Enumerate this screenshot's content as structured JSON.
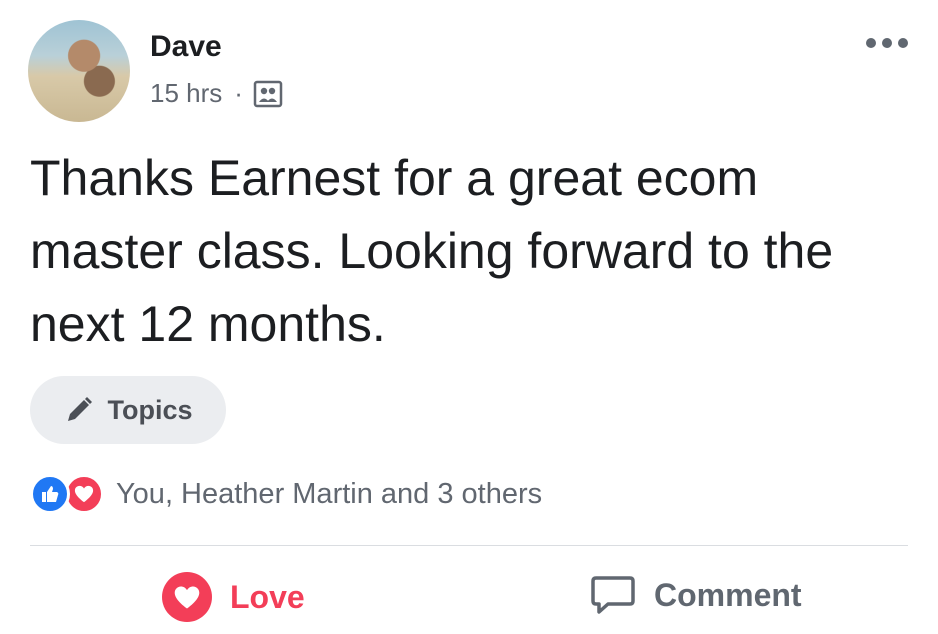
{
  "post": {
    "author": "Dave",
    "time": "15 hrs",
    "separator": "·",
    "audience_icon": "group-audience-icon",
    "more_icon": "more-options-icon",
    "text": "Thanks Earnest for a great ecom master class. Looking forward to the next 12 months.",
    "topics_label": "Topics"
  },
  "reactions": {
    "icons": [
      "like-icon",
      "love-icon"
    ],
    "summary": "You, Heather Martin and 3 others"
  },
  "actions": {
    "love_label": "Love",
    "comment_label": "Comment"
  },
  "colors": {
    "love": "#f33e58",
    "like": "#2078f4",
    "text": "#1c1e21",
    "secondary": "#616770",
    "pill": "#ebedf0"
  }
}
